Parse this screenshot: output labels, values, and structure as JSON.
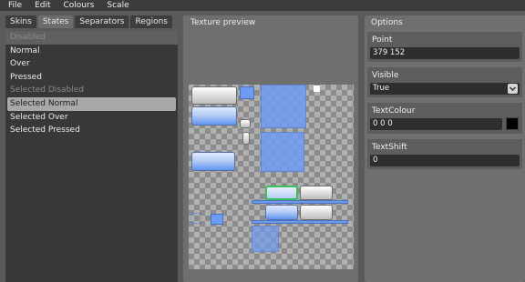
{
  "menubar": {
    "items": [
      "File",
      "Edit",
      "Colours",
      "Scale"
    ]
  },
  "tabs": [
    "Skins",
    "States",
    "Separators",
    "Regions"
  ],
  "active_tab": "States",
  "states": [
    {
      "label": "Disabled",
      "state": "disabled-highlight"
    },
    {
      "label": "Normal",
      "state": "normal"
    },
    {
      "label": "Over",
      "state": "normal"
    },
    {
      "label": "Pressed",
      "state": "normal"
    },
    {
      "label": "Selected Disabled",
      "state": "disabled"
    },
    {
      "label": "Selected Normal",
      "state": "selected"
    },
    {
      "label": "Selected Over",
      "state": "normal"
    },
    {
      "label": "Selected Pressed",
      "state": "normal"
    }
  ],
  "preview": {
    "title": "Texture preview"
  },
  "options": {
    "title": "Options",
    "point": {
      "label": "Point",
      "value": "379 152"
    },
    "visible": {
      "label": "Visible",
      "value": "True",
      "dropdown_icon": "chevron-down-icon"
    },
    "text_colour": {
      "label": "TextColour",
      "value": "0 0 0",
      "swatch_color": "#000000"
    },
    "text_shift": {
      "label": "TextShift",
      "value": "0"
    }
  }
}
